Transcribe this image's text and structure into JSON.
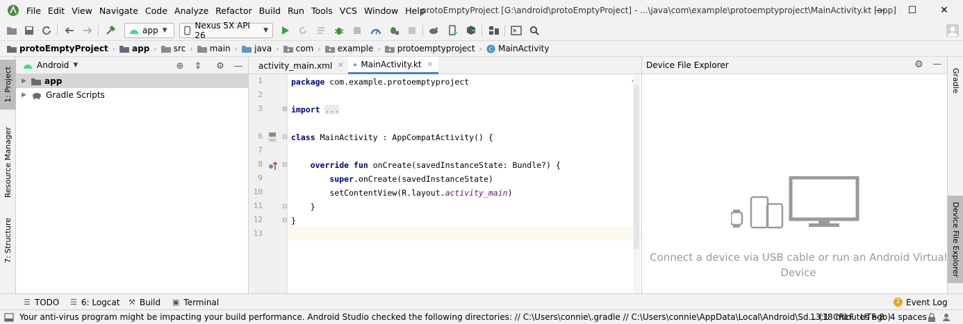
{
  "menubar": {
    "items": [
      "File",
      "Edit",
      "View",
      "Navigate",
      "Code",
      "Analyze",
      "Refactor",
      "Build",
      "Run",
      "Tools",
      "VCS",
      "Window",
      "Help"
    ],
    "window_title": "protoEmptyProject [G:\\android\\protoEmptyProject] - ...\\java\\com\\example\\protoemptyproject\\MainActivity.kt [app]",
    "minimize": "—",
    "maximize": "☐",
    "close": "✕"
  },
  "toolbar": {
    "run_config": "app",
    "device": "Nexus 5X API 26"
  },
  "breadcrumb": [
    "protoEmptyProject",
    "app",
    "src",
    "main",
    "java",
    "com",
    "example",
    "protoemptyproject",
    "MainActivity"
  ],
  "left_stripe": {
    "project_tab": "1: Project",
    "resource_tab": "Resource Manager",
    "structure_tab": "7: Structure"
  },
  "project_panel": {
    "view_mode": "Android",
    "tree": [
      {
        "label": "app",
        "selected": true
      },
      {
        "label": "Gradle Scripts",
        "selected": false
      }
    ]
  },
  "editor": {
    "tabs": [
      {
        "label": "activity_main.xml",
        "active": false
      },
      {
        "label": "MainActivity.kt",
        "active": true
      }
    ],
    "line_numbers": [
      "1",
      "2",
      "3",
      "6",
      "7",
      "8",
      "9",
      "10",
      "11",
      "12",
      "13"
    ]
  },
  "code": {
    "l1_kw": "package",
    "l1_rest": " com.example.protoemptyproject",
    "l3_kw": "import",
    "l3_fold": "...",
    "l6_kw": "class",
    "l6_rest": " MainActivity : AppCompatActivity() {",
    "l8_kw1": "override",
    "l8_kw2": "fun",
    "l8_rest": " onCreate(savedInstanceState: Bundle?) {",
    "l9_kw": "super",
    "l9_rest": ".onCreate(savedInstanceState)",
    "l10_a": "setContentView(R.layout.",
    "l10_it": "activity_main",
    "l10_b": ")",
    "l11": "}",
    "l12": "}"
  },
  "device_explorer": {
    "title": "Device File Explorer",
    "message": "Connect a device via USB cable or run an Android Virtual Device"
  },
  "right_stripe": {
    "gradle_tab": "Gradle",
    "dfe_tab": "Device File Explorer"
  },
  "bottom_tools": {
    "todo": "TODO",
    "logcat": "6: Logcat",
    "build": "Build",
    "terminal": "Terminal",
    "event_log": "Event Log",
    "event_count": "2"
  },
  "status": {
    "message": "Your anti-virus program might be impacting your build performance. Android Studio checked the following directories: // C:\\Users\\connie\\.gradle // C:\\Users\\connie\\AppData\\Local\\Android\\Sd... (18 minutes ago)",
    "position": "13:1",
    "line_sep": "CRLF",
    "encoding": "UTF-8",
    "indent": "4 spaces"
  },
  "colors": {
    "accent": "#4083c9",
    "android_green": "#3ddc84",
    "keyword": "#000080",
    "italic_field": "#660e7a"
  }
}
